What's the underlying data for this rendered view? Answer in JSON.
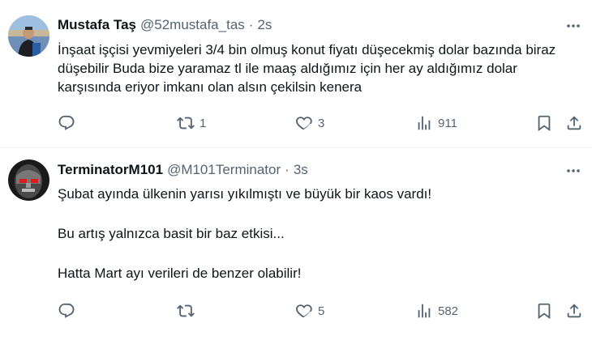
{
  "tweets": [
    {
      "name": "Mustafa Taş",
      "handle": "@52mustafa_tas",
      "separator": "·",
      "time": "2s",
      "text": "İnşaat işçisi yevmiyeleri 3/4 bin olmuş konut fiyatı düşecekmiş dolar bazında biraz düşebilir Buda bize yaramaz tl ile maaş aldığımız için her ay aldığımız dolar karşısında eriyor imkanı olan alsın çekilsin kenera",
      "stats": {
        "replies": "",
        "retweets": "1",
        "likes": "3",
        "views": "911"
      }
    },
    {
      "name": "TerminatorM101",
      "handle": "@M101Terminator",
      "separator": "·",
      "time": "3s",
      "lines": [
        "Şubat ayında ülkenin yarısı yıkılmıştı ve büyük bir kaos vardı!",
        "Bu artış yalnızca basit bir baz etkisi...",
        "Hatta Mart ayı verileri de benzer olabilir!"
      ],
      "stats": {
        "replies": "",
        "retweets": "",
        "likes": "5",
        "views": "582"
      }
    }
  ],
  "icons": {
    "reply": "reply-icon",
    "retweet": "retweet-icon",
    "like": "heart-icon",
    "views": "views-icon",
    "bookmark": "bookmark-icon",
    "share": "share-icon",
    "more": "more-dots-icon"
  },
  "colors": {
    "text": "#0f1419",
    "secondary": "#536471",
    "divider": "#eff3f4"
  }
}
